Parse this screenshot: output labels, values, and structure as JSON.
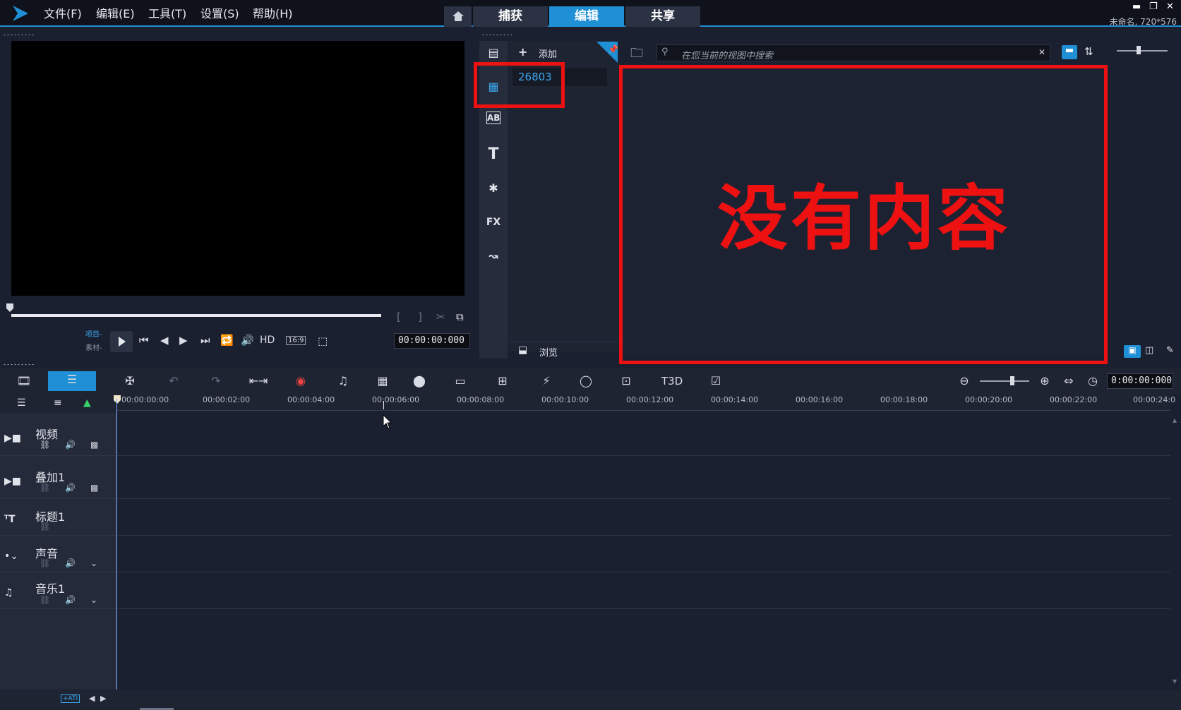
{
  "menu": {
    "file": "文件(F)",
    "edit": "编辑(E)",
    "tools": "工具(T)",
    "settings": "设置(S)",
    "help": "帮助(H)"
  },
  "modes": {
    "capture": "捕获",
    "edit": "编辑",
    "share": "共享"
  },
  "project_info": "未命名, 720*576",
  "preview": {
    "project_label": "项目-",
    "clip_label": "素材-",
    "hd_label": "HD",
    "aspect_label": "16:9",
    "timecode": "00:00:00:000"
  },
  "library": {
    "add_label": "添加",
    "folder_name": "26803",
    "search_placeholder": "在您当前的视图中搜索",
    "browse_label": "浏览",
    "empty_message": "没有内容"
  },
  "timeline": {
    "timecode": "0:00:00:000",
    "ruler_ticks": [
      "00:00:00:00",
      "00:00:02:00",
      "00:00:04:00",
      "00:00:06:00",
      "00:00:08:00",
      "00:00:10:00",
      "00:00:12:00",
      "00:00:14:00",
      "00:00:16:00",
      "00:00:18:00",
      "00:00:20:00",
      "00:00:22:00",
      "00:00:24:0"
    ],
    "tracks": [
      {
        "name": "视频"
      },
      {
        "name": "叠加1"
      },
      {
        "name": "标题1"
      },
      {
        "name": "声音"
      },
      {
        "name": "音乐1"
      }
    ],
    "status_badge": "+ATI"
  },
  "colors": {
    "accent": "#1f8fd6",
    "annotation_red": "#ee1111",
    "panel": "#1b2030"
  }
}
